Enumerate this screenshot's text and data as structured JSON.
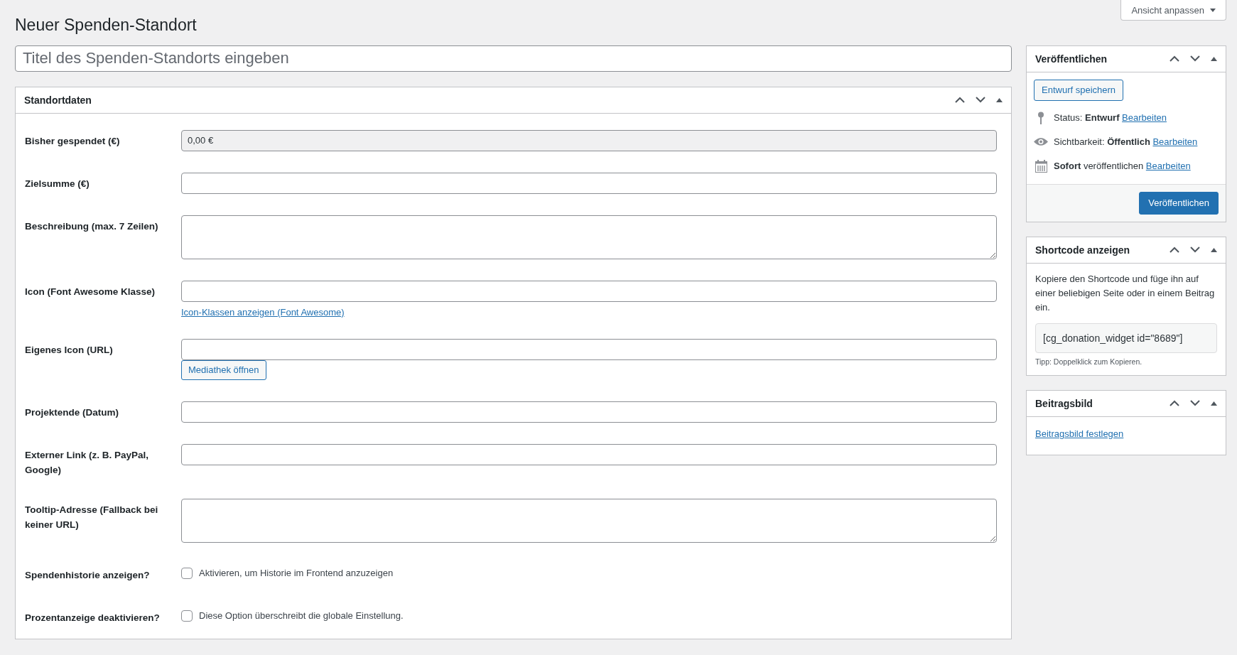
{
  "screen_options": {
    "label": "Ansicht anpassen"
  },
  "page_title": "Neuer Spenden-Standort",
  "title_field": {
    "placeholder": "Titel des Spenden-Standorts eingeben"
  },
  "location_box": {
    "title": "Standortdaten",
    "fields": [
      {
        "kind": "input",
        "label": "Bisher gespendet (€)",
        "value": "0,00 €",
        "readonly": true
      },
      {
        "kind": "input",
        "label": "Zielsumme (€)",
        "readonly": false
      },
      {
        "kind": "textarea",
        "label": "Beschreibung (max. 7 Zeilen)"
      },
      {
        "kind": "input",
        "label": "Icon (Font Awesome Klasse)",
        "readonly": false,
        "link": "Icon-Klassen anzeigen (Font Awesome)"
      },
      {
        "kind": "input",
        "label": "Eigenes Icon (URL)",
        "readonly": false,
        "button": "Mediathek öffnen"
      },
      {
        "kind": "input",
        "label": "Projektende (Datum)",
        "readonly": false
      },
      {
        "kind": "input",
        "label": "Externer Link (z. B. PayPal, Google)",
        "readonly": false
      },
      {
        "kind": "textarea",
        "label": "Tooltip-Adresse (Fallback bei keiner URL)"
      },
      {
        "kind": "checkbox",
        "label": "Spendenhistorie anzeigen?",
        "text": "Aktivieren, um Historie im Frontend anzuzeigen",
        "checked": false
      },
      {
        "kind": "checkbox",
        "label": "Prozentanzeige deaktivieren?",
        "text": "Diese Option überschreibt die globale Einstellung.",
        "checked": false
      }
    ]
  },
  "publish_box": {
    "title": "Veröffentlichen",
    "save_button": "Entwurf speichern",
    "rows": [
      {
        "kind": "pin",
        "text": "Status: **Entwurf**",
        "link": "Bearbeiten"
      },
      {
        "kind": "eye",
        "text": "Sichtbarkeit: **Öffentlich**",
        "link": "Bearbeiten"
      },
      {
        "kind": "calendar",
        "text": "**Sofort** veröffentlichen",
        "link": "Bearbeiten"
      }
    ],
    "publish_button": "Veröffentlichen"
  },
  "shortcode_box": {
    "title": "Shortcode anzeigen",
    "description": "Kopiere den Shortcode und füge ihn auf einer beliebigen Seite oder in einem Beitrag ein.",
    "shortcode": "[cg_donation_widget id=\"8689\"]",
    "hint": "Tipp: Doppelklick zum Kopieren."
  },
  "featured_image_box": {
    "title": "Beitragsbild",
    "link": "Beitragsbild festlegen"
  }
}
